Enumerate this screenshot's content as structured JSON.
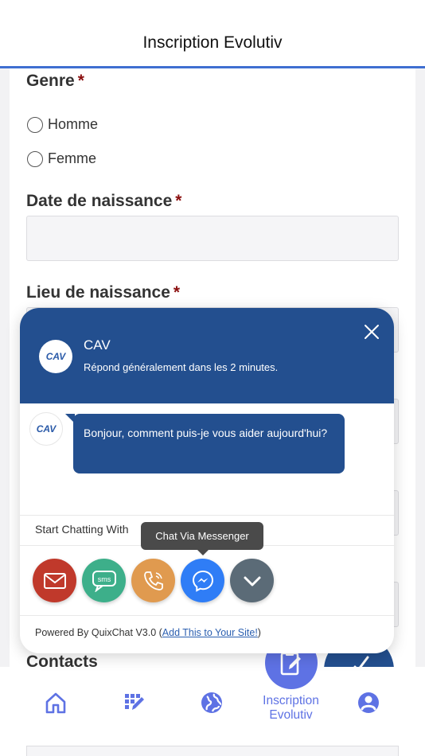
{
  "app_bar": {
    "title": "Inscription Evolutiv"
  },
  "form": {
    "genre": {
      "label": "Genre",
      "required_mark": "*",
      "options": [
        "Homme",
        "Femme"
      ]
    },
    "date_naissance": {
      "label": "Date de naissance",
      "required_mark": "*"
    },
    "lieu_naissance": {
      "label": "Lieu de naissance",
      "required_mark": "*"
    },
    "contacts": {
      "label": "Contacts"
    }
  },
  "chat_widget": {
    "agent_name": "CAV",
    "logo_text": "CAV",
    "response_time": "Répond généralement dans les 2 minutes.",
    "message": "Bonjour, comment puis-je vous aider aujourd'hui?",
    "start_chatting": "Start Chatting With",
    "tooltip": "Chat Via Messenger",
    "channels": [
      {
        "name": "email",
        "icon": "gmail-icon",
        "color": "#c0392b"
      },
      {
        "name": "sms",
        "icon": "sms-icon",
        "color": "#3daf8a"
      },
      {
        "name": "phone",
        "icon": "phone-icon",
        "color": "#e09a4f"
      },
      {
        "name": "messenger",
        "icon": "messenger-icon",
        "color": "#2f7df6"
      },
      {
        "name": "more",
        "icon": "chevron-down-icon",
        "color": "#5b6b77"
      }
    ],
    "powered_by_prefix": "Powered By QuixChat V3.0 (",
    "powered_link": "Add This to Your Site!",
    "powered_suffix": ")"
  },
  "bottom_nav": {
    "items": [
      {
        "icon": "home-icon"
      },
      {
        "icon": "edit-grid-icon"
      },
      {
        "icon": "globe-icon"
      },
      {
        "icon": "clipboard-edit-icon",
        "label": "Inscription Evolutiv",
        "active": true
      },
      {
        "icon": "user-profile-icon"
      }
    ]
  },
  "colors": {
    "primary": "#234f8f",
    "accent": "#5e72e4",
    "required": "#8b0f0f",
    "topbar_border": "#3f6fd1"
  }
}
